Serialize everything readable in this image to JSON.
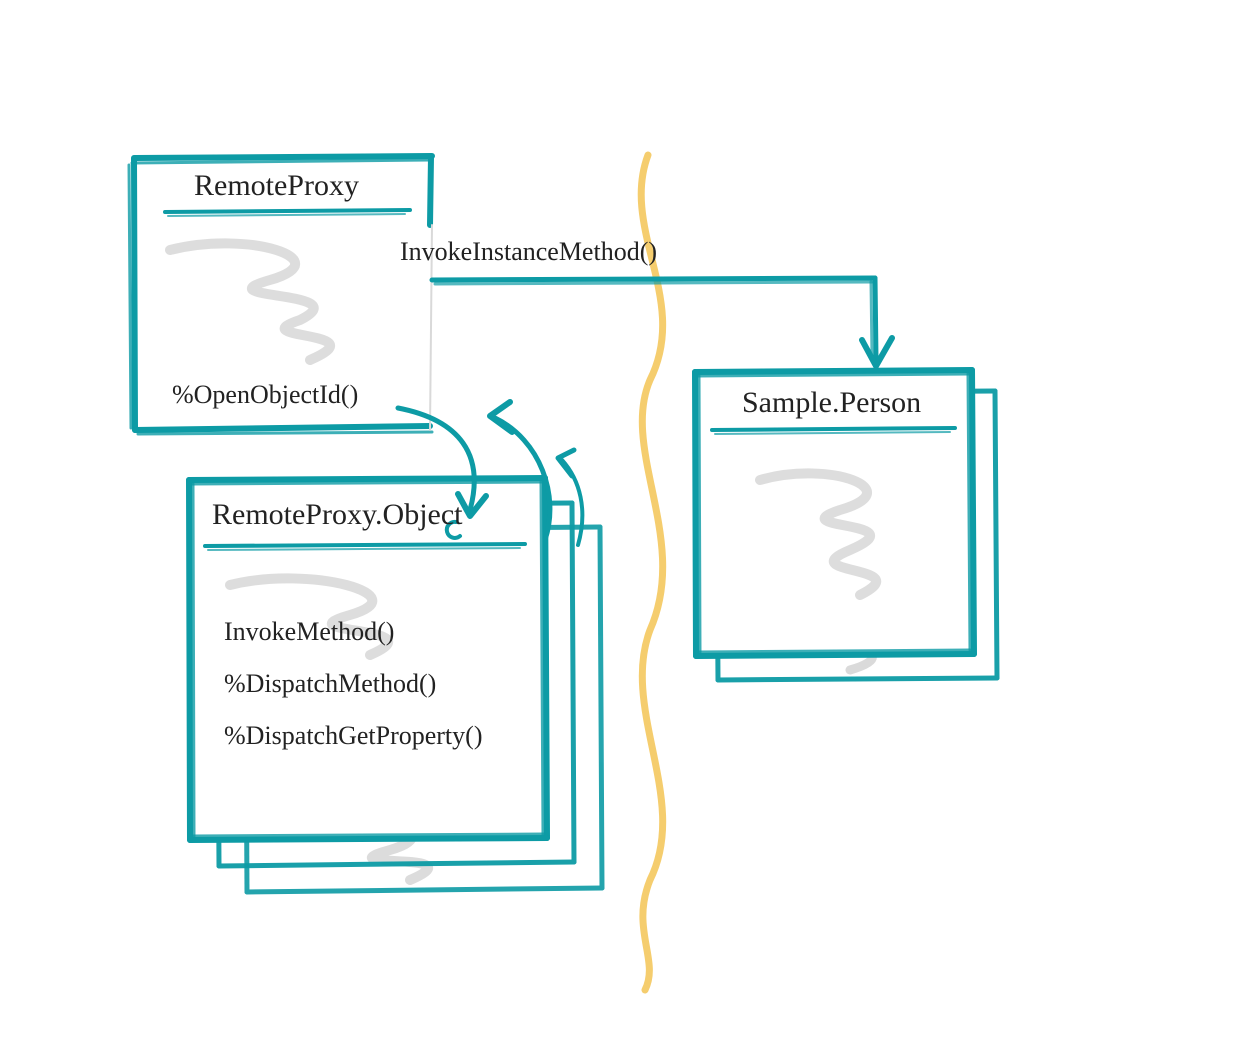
{
  "colors": {
    "teal": "#0d9ba5",
    "tealDark": "#0a7f88",
    "scribble": "#d9d9d9",
    "divider": "#f5cd6e",
    "ink": "#222222"
  },
  "boxes": {
    "remoteProxy": {
      "title": "RemoteProxy",
      "methods": [
        "%OpenObjectId()"
      ]
    },
    "remoteProxyObject": {
      "title": "RemoteProxy.Object",
      "methods": [
        "InvokeMethod()",
        "%DispatchMethod()",
        "%DispatchGetProperty()"
      ]
    },
    "samplePerson": {
      "title": "Sample.Person",
      "methods": []
    }
  },
  "edges": {
    "invokeInstance": "InvokeInstanceMethod()"
  }
}
